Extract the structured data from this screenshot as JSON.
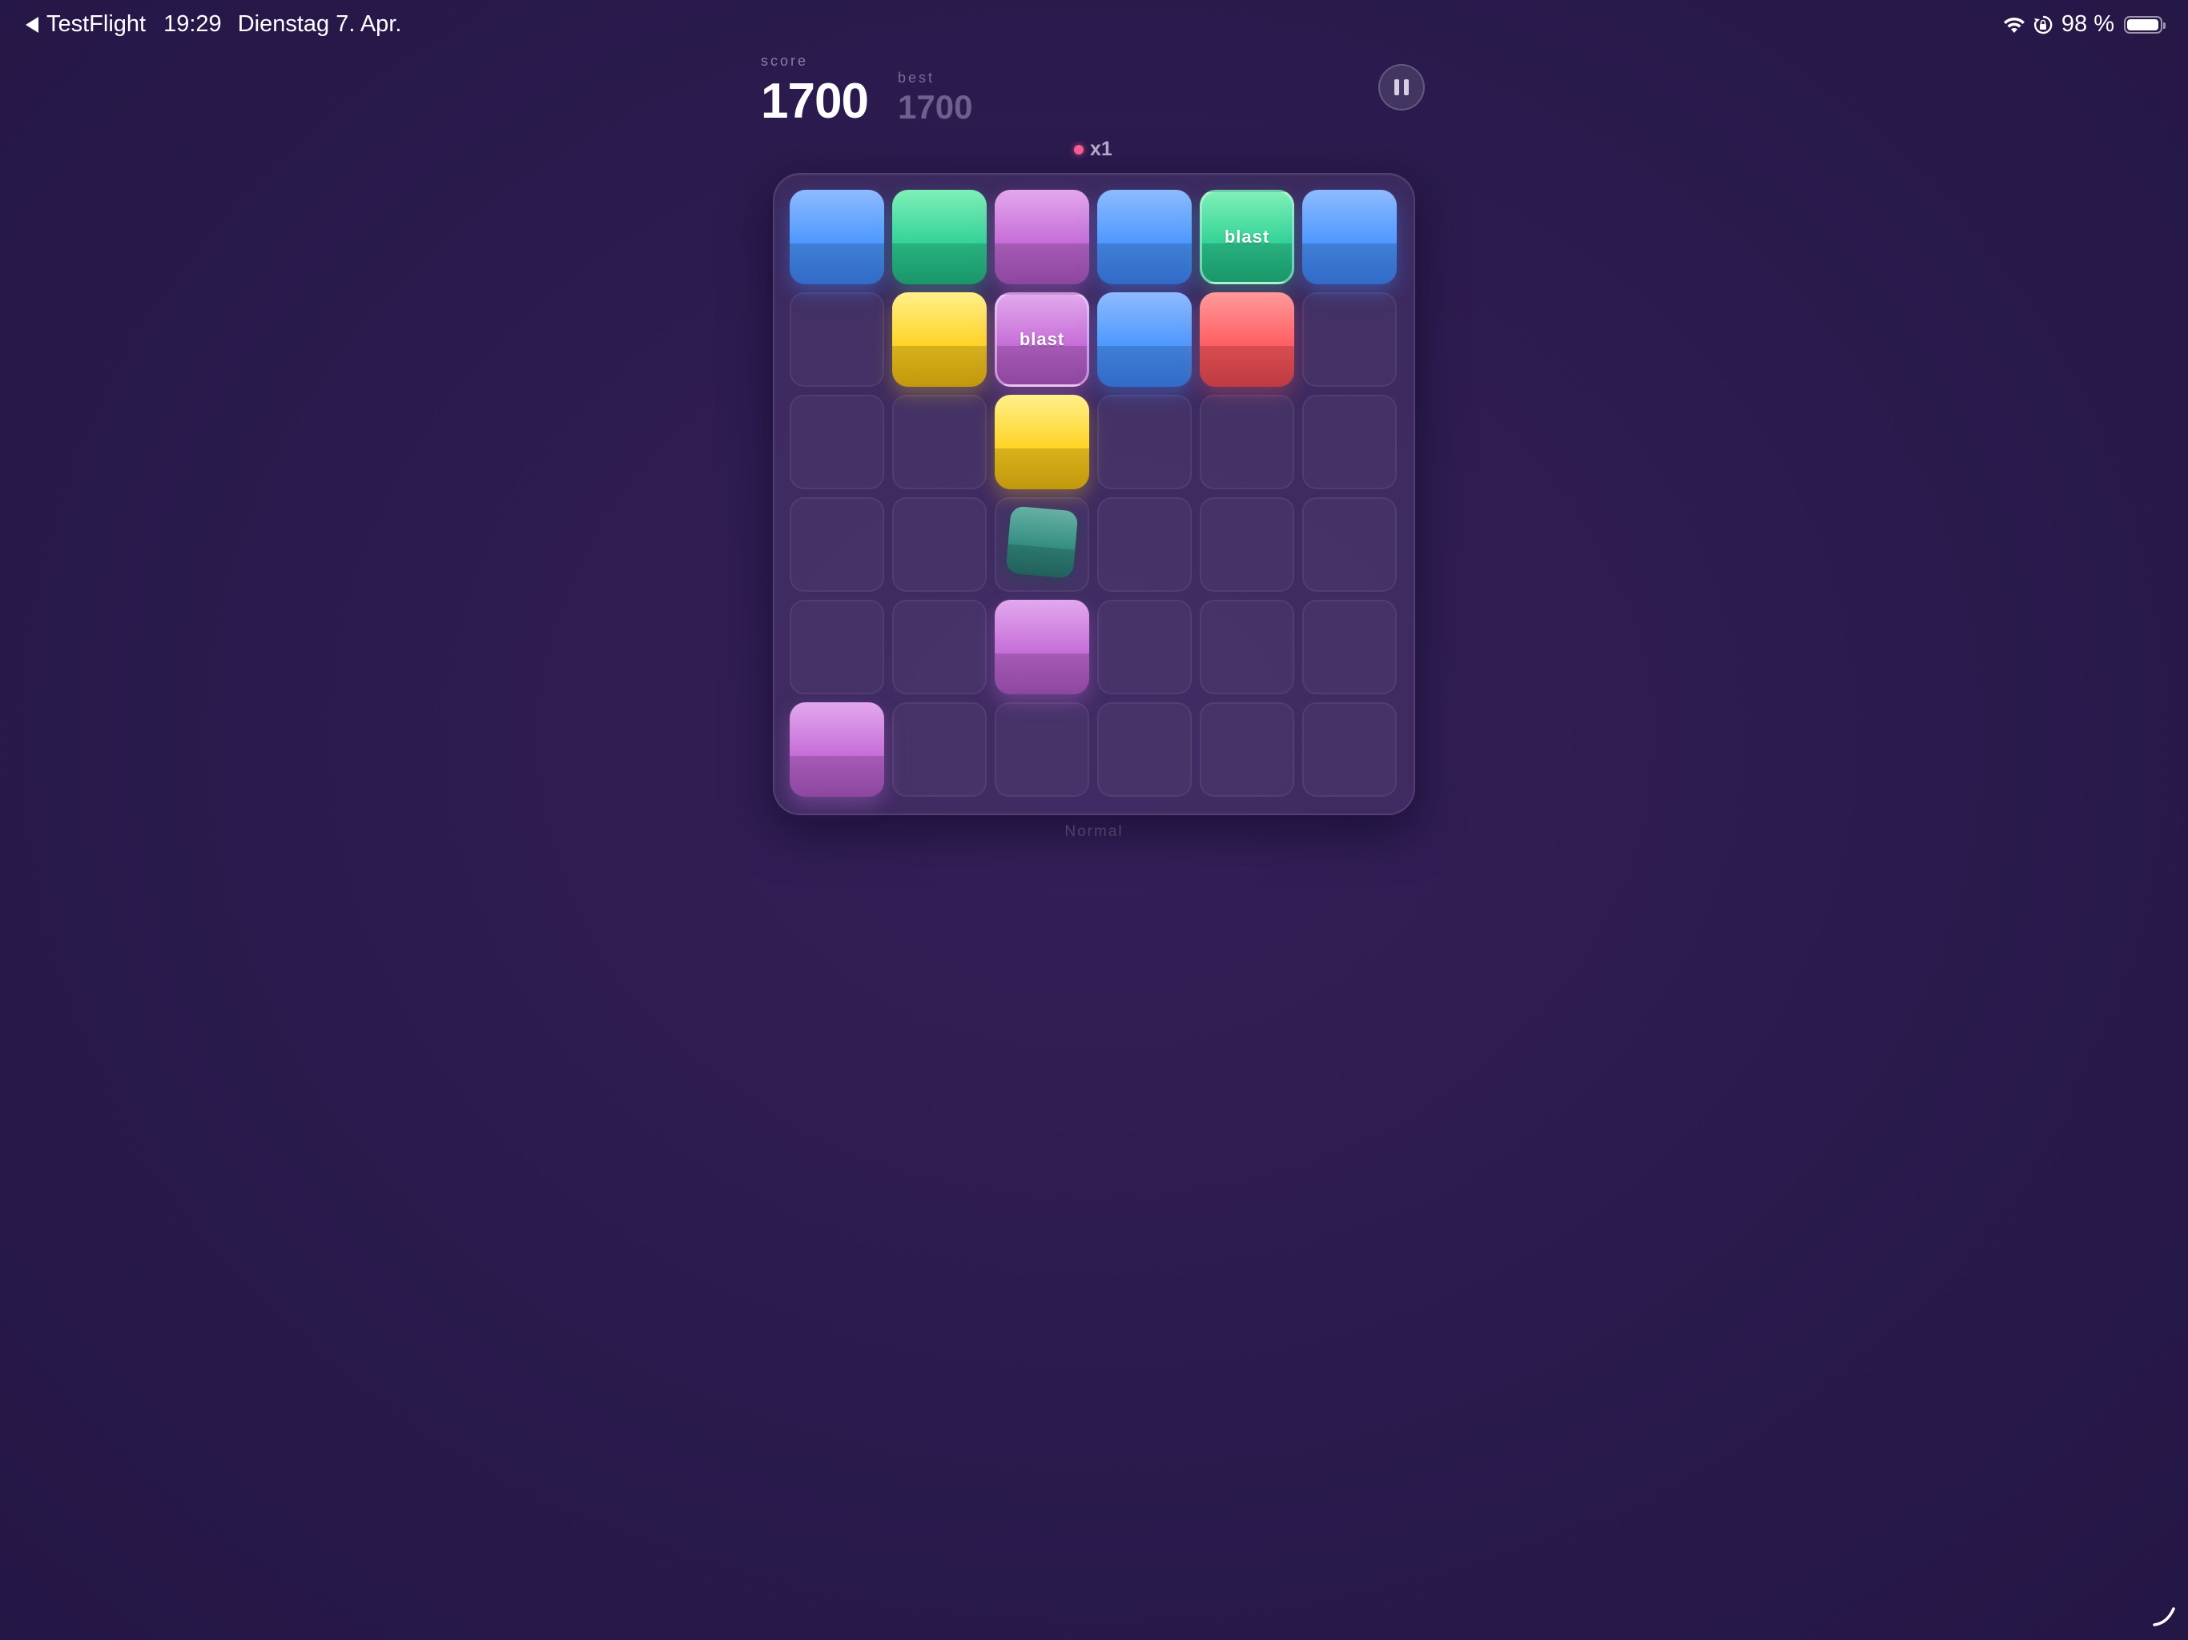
{
  "status_bar": {
    "back_label": "TestFlight",
    "time": "19:29",
    "date": "Dienstag 7. Apr.",
    "battery_text": "98 %",
    "battery_level": 0.98,
    "icons": [
      "back-arrow-icon",
      "wifi-icon",
      "orientation-lock-icon",
      "battery-icon"
    ]
  },
  "header": {
    "score_label": "score",
    "score_value": "1700",
    "best_label": "best",
    "best_value": "1700",
    "pause_icon": "pause-icon",
    "combo_text": "x1",
    "combo_dot_color": "#ff5d95"
  },
  "board": {
    "rows": 6,
    "cols": 6,
    "tiles": [
      {
        "row": 0,
        "col": 0,
        "color": "blue",
        "label": ""
      },
      {
        "row": 0,
        "col": 1,
        "color": "green",
        "label": ""
      },
      {
        "row": 0,
        "col": 2,
        "color": "purple",
        "label": ""
      },
      {
        "row": 0,
        "col": 3,
        "color": "blue",
        "label": ""
      },
      {
        "row": 0,
        "col": 4,
        "color": "green",
        "label": "blast"
      },
      {
        "row": 0,
        "col": 5,
        "color": "blue",
        "label": ""
      },
      {
        "row": 1,
        "col": 1,
        "color": "yellow",
        "label": ""
      },
      {
        "row": 1,
        "col": 2,
        "color": "purple",
        "label": "blast"
      },
      {
        "row": 1,
        "col": 3,
        "color": "blue",
        "label": ""
      },
      {
        "row": 1,
        "col": 4,
        "color": "red",
        "label": ""
      },
      {
        "row": 2,
        "col": 2,
        "color": "yellow",
        "label": ""
      },
      {
        "row": 3,
        "col": 2,
        "color": "teal",
        "label": "",
        "falling": true
      },
      {
        "row": 4,
        "col": 2,
        "color": "purple",
        "label": ""
      },
      {
        "row": 5,
        "col": 0,
        "color": "purple",
        "label": ""
      }
    ],
    "colors": {
      "blue": "#4a96ff",
      "green": "#2fd195",
      "purple": "#c46ad6",
      "yellow": "#ffd21f",
      "red": "#ff5a5f",
      "teal": "#2f9c85"
    }
  },
  "footer": {
    "mode_label": "Normal"
  }
}
